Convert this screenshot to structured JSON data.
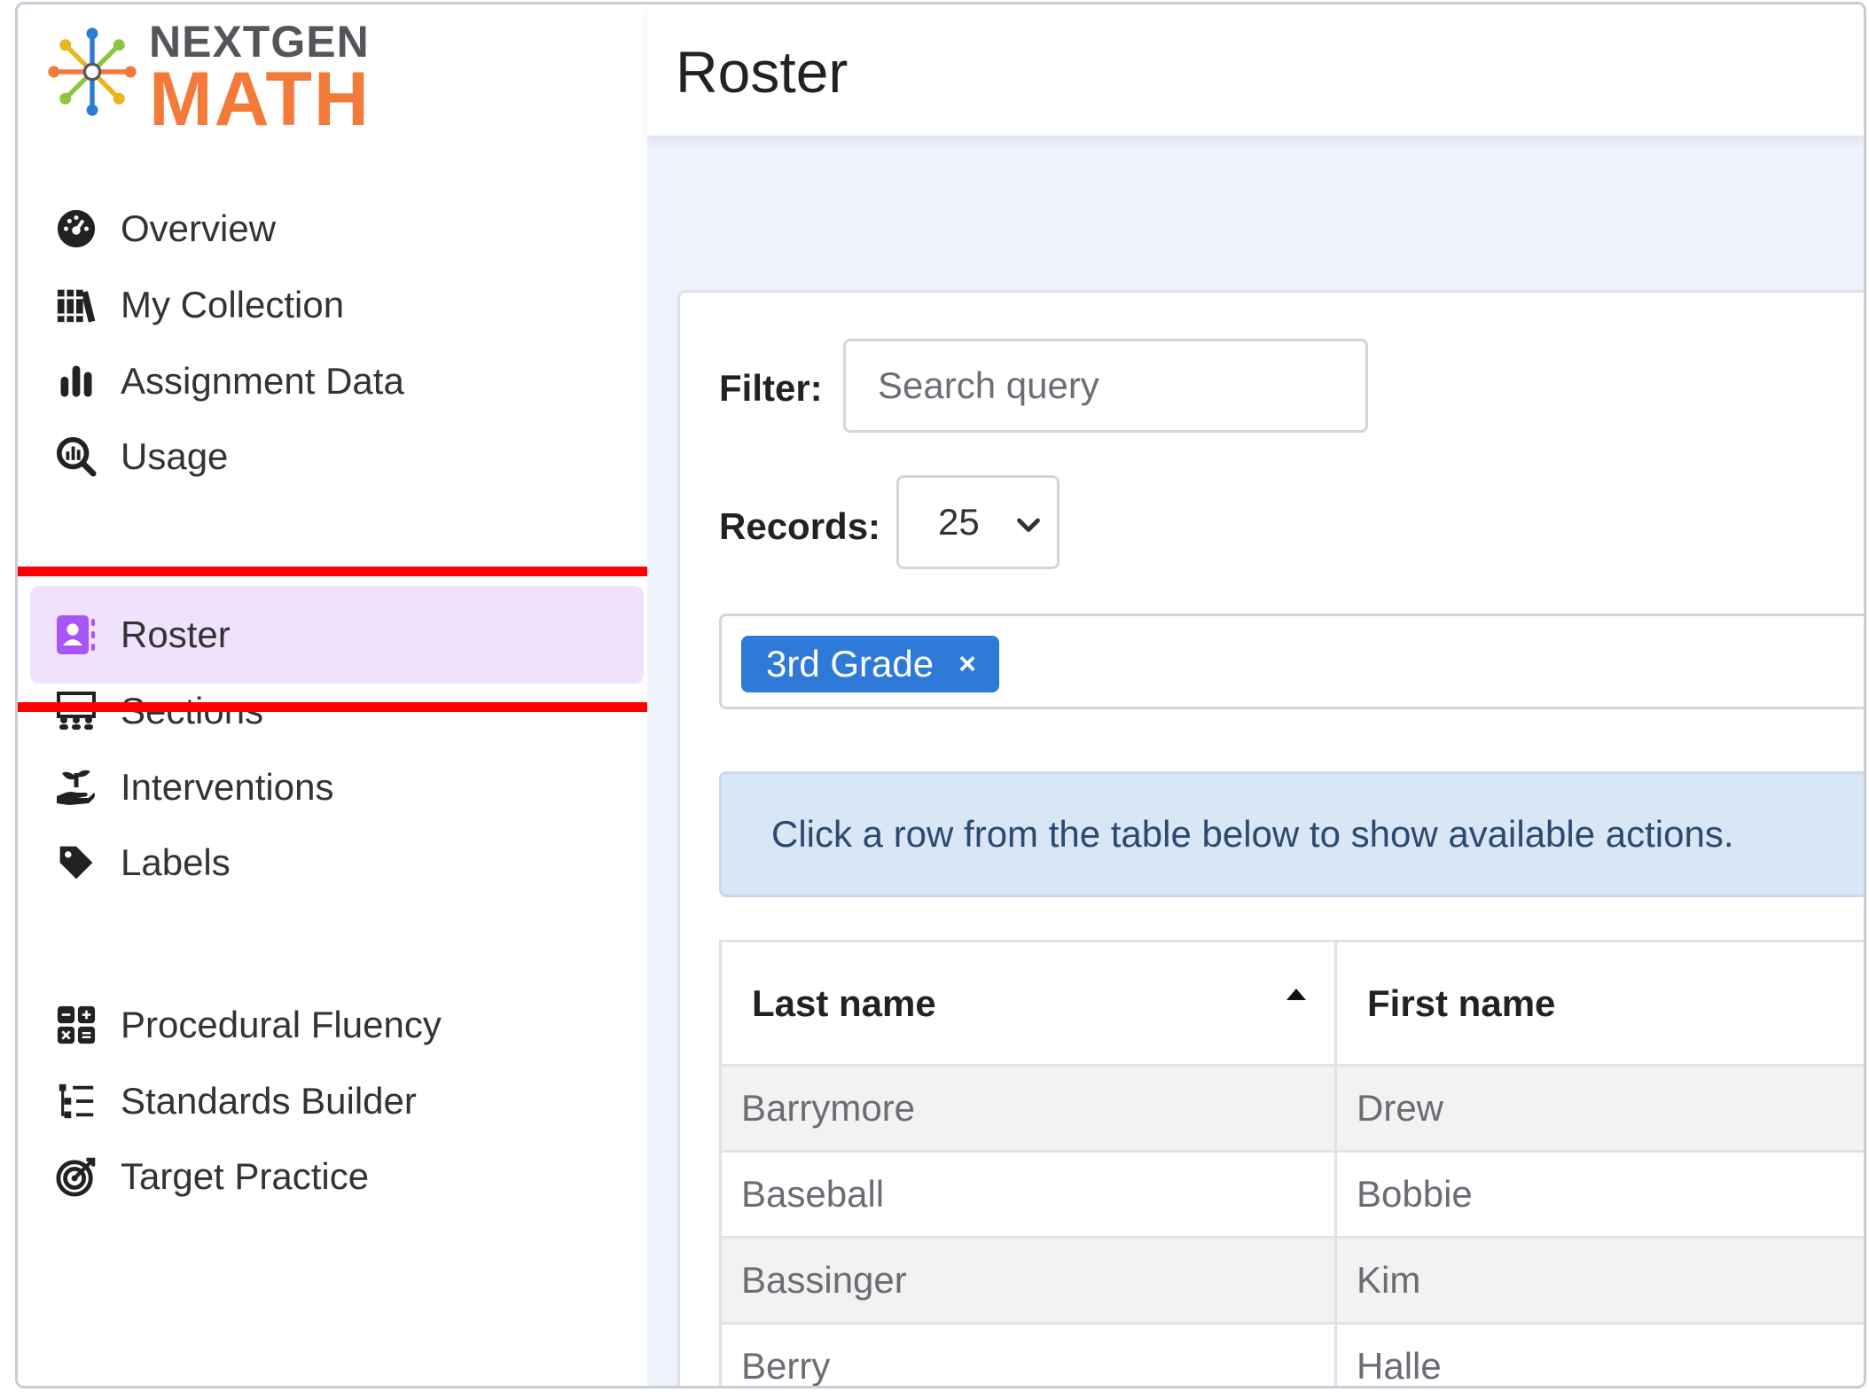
{
  "brand": {
    "line1": "NEXTGEN",
    "line2": "MATH",
    "colors": {
      "orange": "#f47a3a",
      "gray": "#53565a",
      "green": "#8cc63f"
    }
  },
  "sidebar": {
    "items": [
      {
        "label": "Overview",
        "icon": "dashboard-gauge-icon"
      },
      {
        "label": "My Collection",
        "icon": "books-icon"
      },
      {
        "label": "Assignment Data",
        "icon": "bar-chart-icon"
      },
      {
        "label": "Usage",
        "icon": "magnify-chart-icon"
      },
      {
        "label": "Roster",
        "icon": "contact-book-icon",
        "active": true
      },
      {
        "label": "Sections",
        "icon": "classroom-icon"
      },
      {
        "label": "Interventions",
        "icon": "hand-seedling-icon"
      },
      {
        "label": "Labels",
        "icon": "tag-icon"
      },
      {
        "label": "Procedural Fluency",
        "icon": "calculator-grid-icon"
      },
      {
        "label": "Standards Builder",
        "icon": "list-tree-icon"
      },
      {
        "label": "Target Practice",
        "icon": "target-icon"
      }
    ],
    "active_color": "#f0e2fc",
    "highlight_color": "#ff0000"
  },
  "header": {
    "title": "Roster"
  },
  "filters": {
    "filter_label": "Filter:",
    "search_placeholder": "Search query",
    "records_label": "Records:",
    "records_value": "25",
    "tags": [
      {
        "label": "3rd Grade",
        "remove": "×"
      }
    ],
    "tag_color": "#2f7ad9"
  },
  "info": {
    "message": "Click a row from the table below to show available actions."
  },
  "table": {
    "columns": [
      "Last name",
      "First name"
    ],
    "sort": {
      "column": "Last name",
      "direction": "ascending"
    },
    "rows": [
      [
        "Barrymore",
        "Drew"
      ],
      [
        "Baseball",
        "Bobbie"
      ],
      [
        "Bassinger",
        "Kim"
      ],
      [
        "Berry",
        "Halle"
      ]
    ]
  }
}
